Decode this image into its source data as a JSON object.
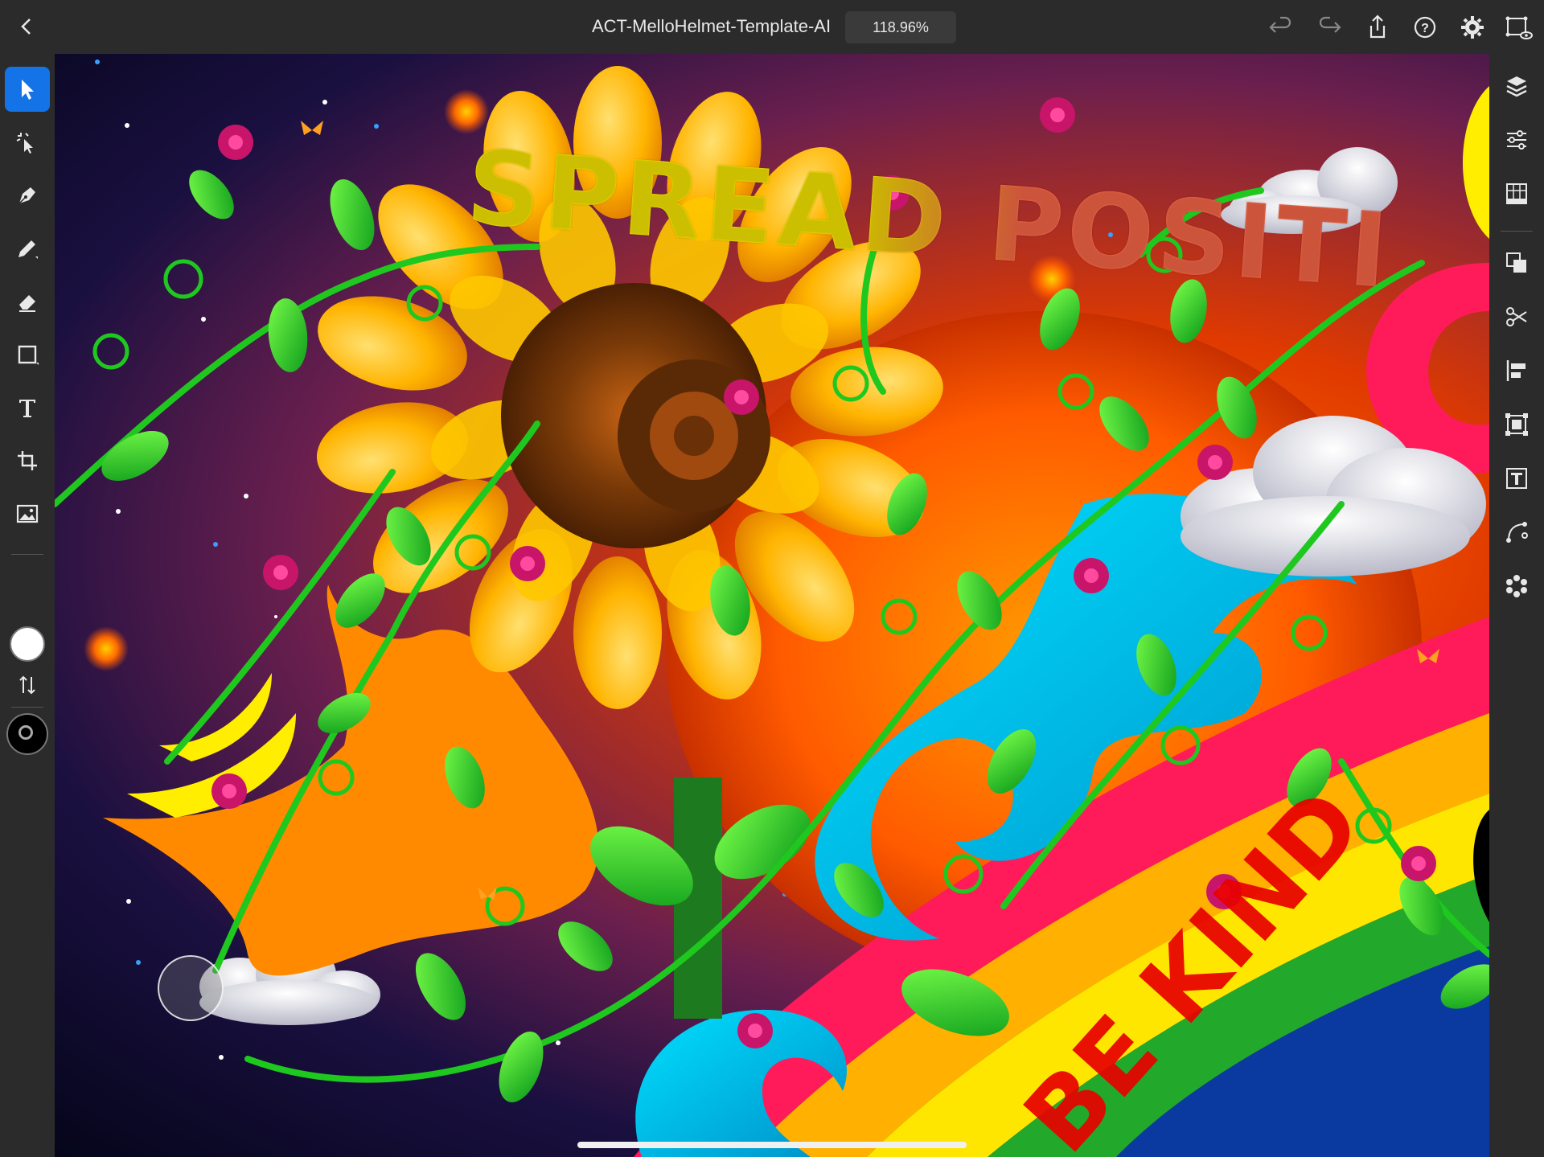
{
  "app": {
    "document_title": "ACT-MelloHelmet-Template-AI",
    "zoom_level": "118.96%"
  },
  "topbar_icons": [
    "back-icon",
    "undo-icon",
    "redo-icon",
    "share-icon",
    "help-icon",
    "settings-icon",
    "preview-icon"
  ],
  "left_toolbar": {
    "tools": [
      "selection-tool",
      "direct-selection-tool",
      "pen-tool",
      "pencil-tool",
      "eraser-tool",
      "rectangle-tool",
      "type-tool",
      "transform-tool",
      "place-image-tool"
    ],
    "active_tool": "selection-tool",
    "fill_color": "#ffffff",
    "stroke_color": "#000000"
  },
  "right_panel": {
    "items": [
      "layers-icon",
      "properties-icon",
      "grid-icon",
      "pathfinder-icon",
      "scissors-icon",
      "align-icon",
      "transform-icon",
      "type-options-icon",
      "path-icon",
      "repeat-icon"
    ]
  },
  "artwork": {
    "headline_visible": "SPREAD POSITI",
    "ribbon_text": "BE KIND",
    "colors": {
      "headline_yellow": "#ffee00",
      "headline_coral": "#ff6a4a",
      "sunflower": "#ffb400",
      "vine_green": "#1fc81f",
      "flower_magenta": "#c8156a",
      "wave_cyan": "#00c8e8",
      "ribbon_pink": "#ff1a5a"
    }
  }
}
